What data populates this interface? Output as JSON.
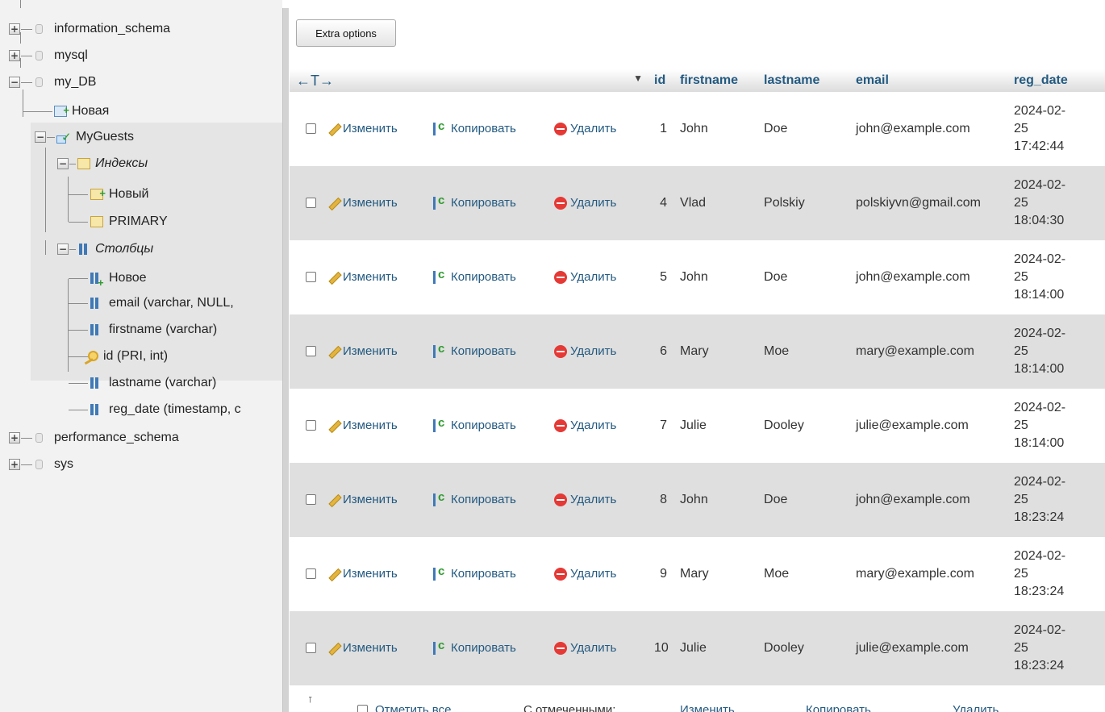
{
  "sidebar": {
    "databases": [
      {
        "name": "information_schema",
        "toggle": "+"
      },
      {
        "name": "mysql",
        "toggle": "+"
      },
      {
        "name": "my_DB",
        "toggle": "−"
      },
      {
        "name": "performance_schema",
        "toggle": "+"
      },
      {
        "name": "sys",
        "toggle": "+"
      }
    ],
    "new_table": "Новая",
    "table": {
      "name": "MyGuests",
      "toggle": "−"
    },
    "indexes_group": {
      "label": "Индексы",
      "toggle": "−"
    },
    "indexes": [
      "Новый",
      "PRIMARY"
    ],
    "columns_group": {
      "label": "Столбцы",
      "toggle": "−"
    },
    "columns": [
      {
        "label": "Новое",
        "icon": "new-column-icon"
      },
      {
        "label": "email (varchar, NULL, ",
        "icon": "column-icon"
      },
      {
        "label": "firstname (varchar)",
        "icon": "column-icon"
      },
      {
        "label": "id (PRI, int)",
        "icon": "key-icon"
      },
      {
        "label": "lastname (varchar)",
        "icon": "column-icon"
      },
      {
        "label": "reg_date (timestamp, c",
        "icon": "column-icon"
      }
    ]
  },
  "toolbar": {
    "extra_options": "Extra options"
  },
  "table": {
    "arrows": "←T→",
    "sort_caret": "▼",
    "columns": [
      "id",
      "firstname",
      "lastname",
      "email",
      "reg_date"
    ],
    "actions": {
      "edit": "Изменить",
      "copy": "Копировать",
      "delete": "Удалить"
    },
    "rows": [
      {
        "id": "1",
        "firstname": "John",
        "lastname": "Doe",
        "email": "john@example.com",
        "reg_date": [
          "2024-02-",
          "25",
          "17:42:44"
        ]
      },
      {
        "id": "4",
        "firstname": "Vlad",
        "lastname": "Polskiy",
        "email": "polskiyvn@gmail.com",
        "reg_date": [
          "2024-02-",
          "25",
          "18:04:30"
        ]
      },
      {
        "id": "5",
        "firstname": "John",
        "lastname": "Doe",
        "email": "john@example.com",
        "reg_date": [
          "2024-02-",
          "25",
          "18:14:00"
        ]
      },
      {
        "id": "6",
        "firstname": "Mary",
        "lastname": "Moe",
        "email": "mary@example.com",
        "reg_date": [
          "2024-02-",
          "25",
          "18:14:00"
        ]
      },
      {
        "id": "7",
        "firstname": "Julie",
        "lastname": "Dooley",
        "email": "julie@example.com",
        "reg_date": [
          "2024-02-",
          "25",
          "18:14:00"
        ]
      },
      {
        "id": "8",
        "firstname": "John",
        "lastname": "Doe",
        "email": "john@example.com",
        "reg_date": [
          "2024-02-",
          "25",
          "18:23:24"
        ]
      },
      {
        "id": "9",
        "firstname": "Mary",
        "lastname": "Moe",
        "email": "mary@example.com",
        "reg_date": [
          "2024-02-",
          "25",
          "18:23:24"
        ]
      },
      {
        "id": "10",
        "firstname": "Julie",
        "lastname": "Dooley",
        "email": "julie@example.com",
        "reg_date": [
          "2024-02-",
          "25",
          "18:23:24"
        ]
      }
    ]
  },
  "footer": {
    "check_all": "Отметить все",
    "with_selected": "С отмеченными:",
    "edit": "Изменить",
    "copy": "Копировать",
    "delete": "Удалить"
  }
}
